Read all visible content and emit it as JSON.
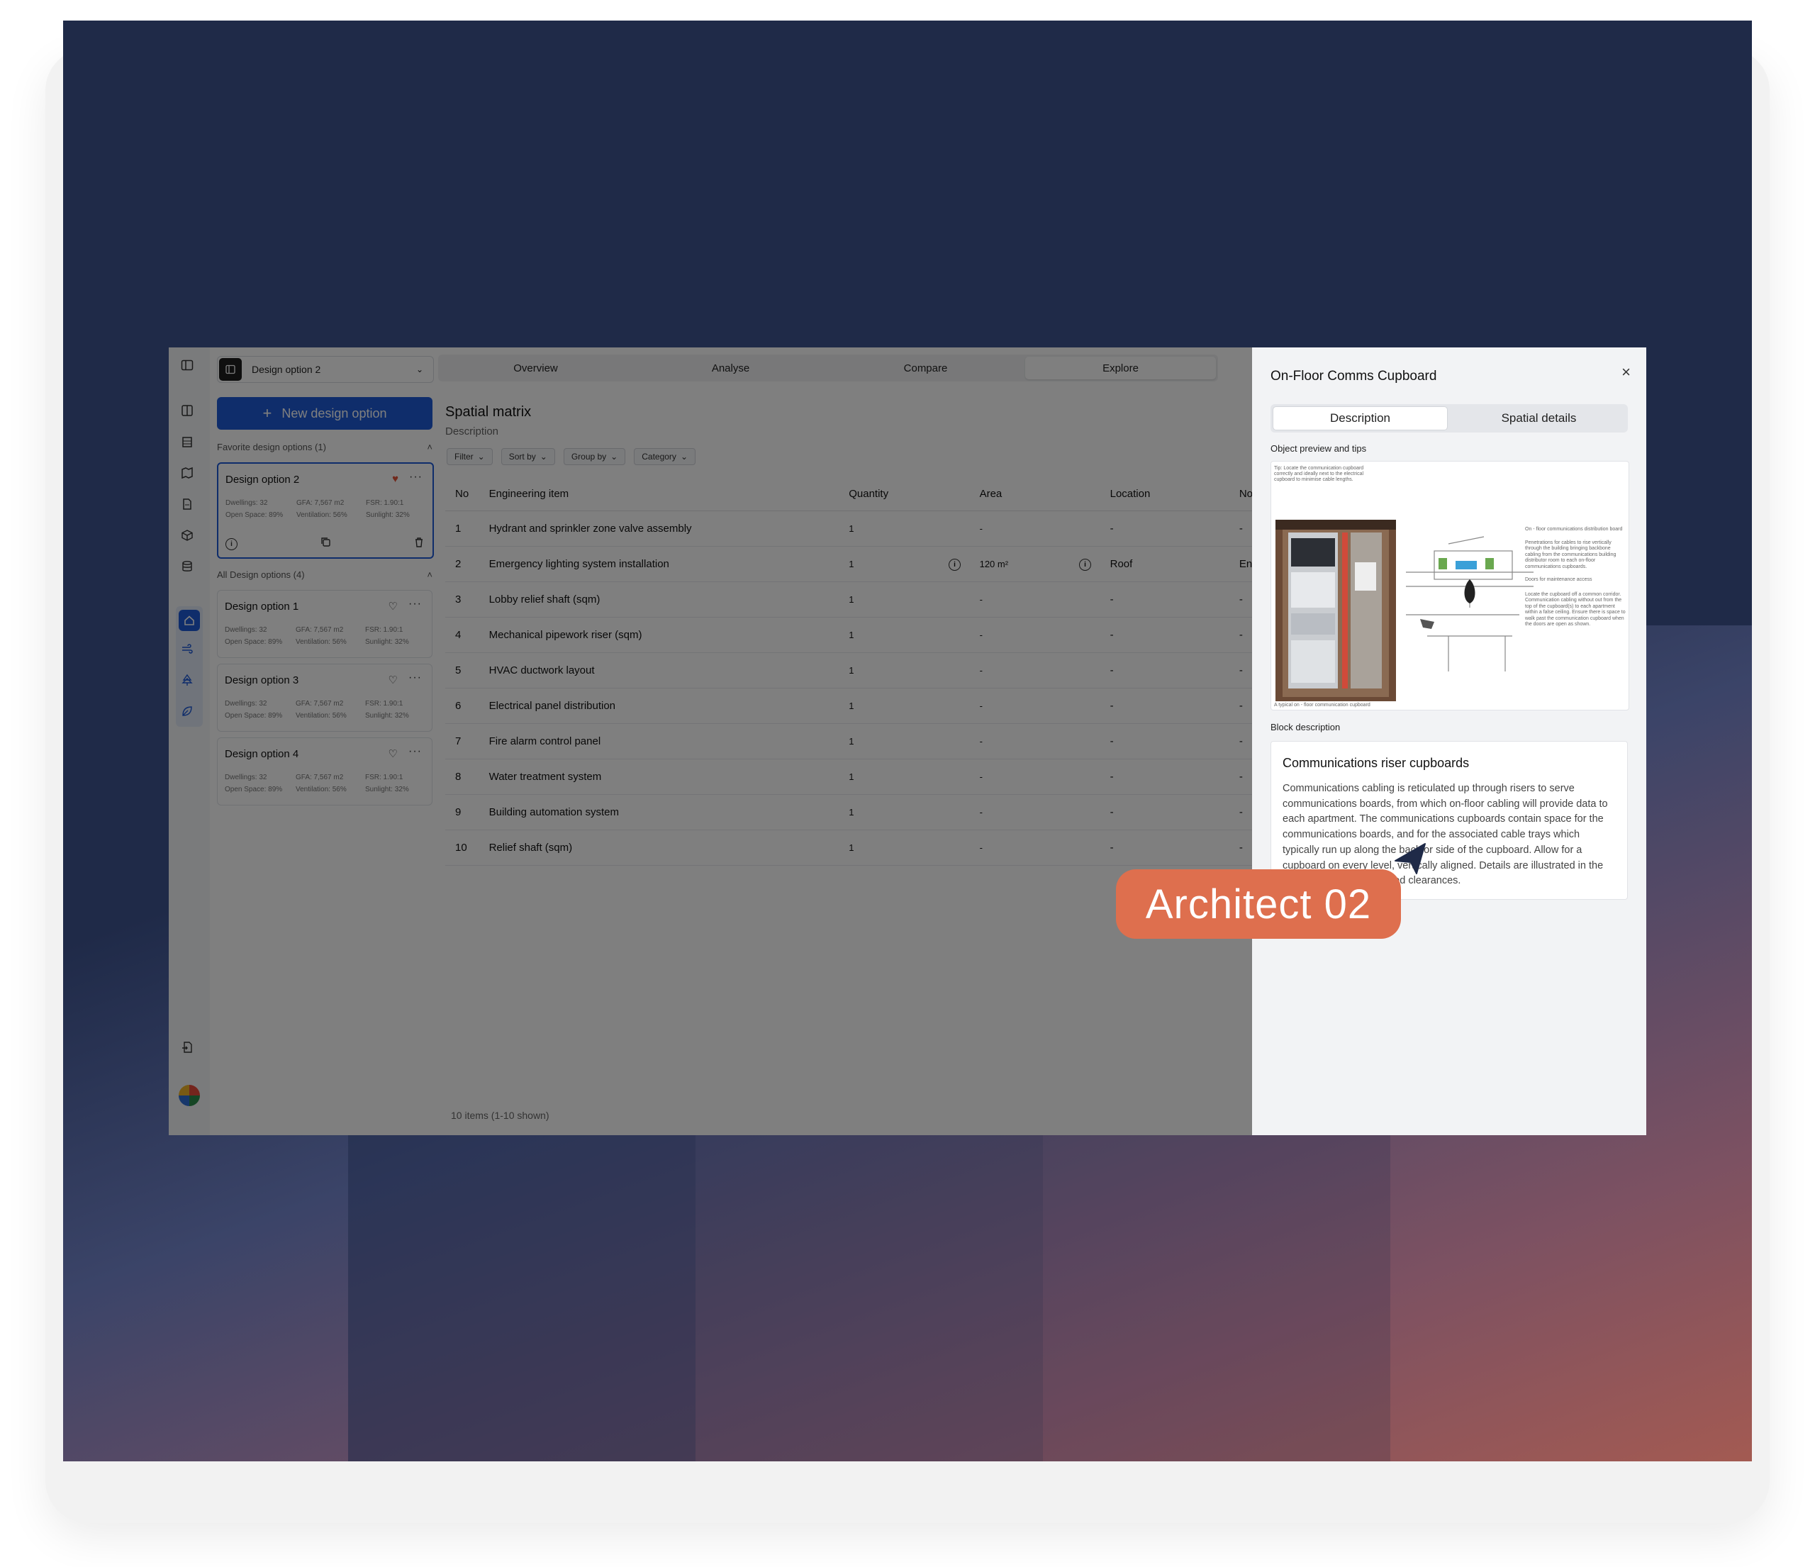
{
  "header": {
    "design_select": "Design option 2"
  },
  "sidebar": {
    "new_button": "New design option",
    "favorites_header": "Favorite design options (1)",
    "all_header": "All Design options (4)",
    "favorite_card": {
      "title": "Design option 2",
      "dwellings": "Dwellings: 32",
      "gfa": "GFA: 7,567 m2",
      "fsr": "FSR: 1.90:1",
      "open_space": "Open Space: 89%",
      "ventilation": "Ventilation: 56%",
      "sunlight": "Sunlight: 32%"
    },
    "cards": [
      {
        "title": "Design option 1",
        "dwellings": "Dwellings: 32",
        "gfa": "GFA: 7,567 m2",
        "fsr": "FSR: 1.90:1",
        "open_space": "Open Space: 89%",
        "ventilation": "Ventilation: 56%",
        "sunlight": "Sunlight: 32%"
      },
      {
        "title": "Design option 3",
        "dwellings": "Dwellings: 32",
        "gfa": "GFA: 7,567 m2",
        "fsr": "FSR: 1.90:1",
        "open_space": "Open Space: 89%",
        "ventilation": "Ventilation: 56%",
        "sunlight": "Sunlight: 32%"
      },
      {
        "title": "Design option 4",
        "dwellings": "Dwellings: 32",
        "gfa": "GFA: 7,567 m2",
        "fsr": "FSR: 1.90:1",
        "open_space": "Open Space: 89%",
        "ventilation": "Ventilation: 56%",
        "sunlight": "Sunlight: 32%"
      }
    ]
  },
  "tabs": [
    "Overview",
    "Analyse",
    "Compare",
    "Explore"
  ],
  "main": {
    "title": "Spatial matrix",
    "description": "Description",
    "chips": [
      "Filter",
      "Sort by",
      "Group by",
      "Category"
    ],
    "columns": {
      "no": "No",
      "item": "Engineering item",
      "qty": "Quantity",
      "area": "Area",
      "location": "Location",
      "extra": "No"
    },
    "rows": [
      {
        "no": "1",
        "item": "Hydrant and sprinkler zone valve assembly",
        "qty": "1",
        "area": "-",
        "location": "-",
        "extra": "-"
      },
      {
        "no": "2",
        "item": "Emergency lighting system installation",
        "qty": "1",
        "area": "120 m²",
        "location": "Roof",
        "extra": "En"
      },
      {
        "no": "3",
        "item": "Lobby relief shaft (sqm)",
        "qty": "1",
        "area": "-",
        "location": "-",
        "extra": "-"
      },
      {
        "no": "4",
        "item": "Mechanical pipework riser (sqm)",
        "qty": "1",
        "area": "-",
        "location": "-",
        "extra": "-"
      },
      {
        "no": "5",
        "item": "HVAC ductwork layout",
        "qty": "1",
        "area": "-",
        "location": "-",
        "extra": "-"
      },
      {
        "no": "6",
        "item": "Electrical panel distribution",
        "qty": "1",
        "area": "-",
        "location": "-",
        "extra": "-"
      },
      {
        "no": "7",
        "item": "Fire alarm control panel",
        "qty": "1",
        "area": "-",
        "location": "-",
        "extra": "-"
      },
      {
        "no": "8",
        "item": "Water treatment system",
        "qty": "1",
        "area": "-",
        "location": "-",
        "extra": "-"
      },
      {
        "no": "9",
        "item": "Building automation system",
        "qty": "1",
        "area": "-",
        "location": "-",
        "extra": "-"
      },
      {
        "no": "10",
        "item": "Relief shaft (sqm)",
        "qty": "1",
        "area": "-",
        "location": "-",
        "extra": "-"
      }
    ],
    "footer": "10 items (1-10 shown)"
  },
  "drawer": {
    "title": "On-Floor Comms Cupboard",
    "tabs": [
      "Description",
      "Spatial details"
    ],
    "preview_label": "Object preview and tips",
    "preview_tip": "Tip: Locate the communication cupboard correctly and ideally next to the electrical cupboard to minimise cable lengths.",
    "preview_caption": "A typical on - floor communication cupboard",
    "preview_notes": [
      "On - floor communications distribution board",
      "Penetrations for cables to rise vertically through the building bringing backbone cabling from the communications building distributor room to each on-floor communications cupboards.",
      "Doors for maintenance access",
      "Locate the cupboard off a common corridor. Communication cabling without out from the top of the cupboard(s) to each apartment within a false ceiling. Ensure there is space to walk past the communication cupboard when the doors are open as shown."
    ],
    "block_label": "Block description",
    "block_title": "Communications riser cupboards",
    "block_text": "Communications cabling is reticulated up through risers to serve communications boards, from which on-floor cabling will provide data to each apartment. The communications cupboards contain space for the communications boards, and for the associated cable trays which typically run up along the back or side of the cupboard. Allow for a cupboard on every level, vertically aligned. Details are illustrated in the drawings, with the required clearances."
  },
  "badge": "Architect 02",
  "colors": {
    "accent": "#1e5bd6",
    "badge": "#de6f4e",
    "stage": "#1f2a48",
    "favorite": "#e3553a"
  }
}
